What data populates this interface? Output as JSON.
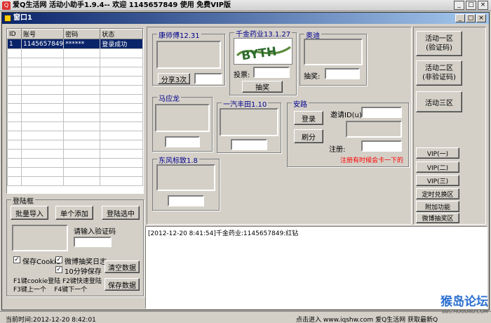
{
  "app": {
    "title": "爱Q生活网 活动小助手1.9.4-- 欢迎 1145657849 使用 免费VIP版"
  },
  "window": {
    "title": "窗口1"
  },
  "accounts": {
    "columns": [
      "ID",
      "账号",
      "密码",
      "状态"
    ],
    "rows": [
      {
        "id": "1",
        "account": "1145657849",
        "password": "******",
        "status": "登录成功"
      }
    ]
  },
  "login": {
    "title": "登陆框",
    "batch_import": "批量导入",
    "add_single": "单个添加",
    "login_selected": "登陆选中",
    "captcha_label": "请输入验证码",
    "save_cookie": "保存Cookie",
    "weibo_log": "微博抽奖日志",
    "save_10min": "10分钟保存",
    "clear_data": "清空数据",
    "save_data": "保存数据",
    "hotkeys_1": "F1键cookie登陆 F2键快速登陆",
    "hotkeys_2": "F3键上一个    F4键下一个"
  },
  "groups": {
    "kangshifu": {
      "title": "康师傅12.31",
      "share_button": "分享3次"
    },
    "qianjin": {
      "title": "千金药业13.1.27",
      "vote_label": "投票:",
      "draw_button": "抽奖",
      "captcha_text": "BYTH"
    },
    "aodi": {
      "title": "奥迪",
      "draw_label": "抽奖:"
    },
    "mayinglong": {
      "title": "马应龙"
    },
    "yiqi": {
      "title": "一汽丰田1.10"
    },
    "anlu": {
      "title": "安路",
      "login_button": "登录",
      "refresh_button": "刷分",
      "invite_label": "邀请ID(u)",
      "register_label": "注册:",
      "hint": "注册有时候会卡一下的"
    },
    "dongfeng": {
      "title": "东风标致1.8"
    }
  },
  "right_buttons": {
    "activity_1": "活动一区\n(验证码)",
    "activity_2": "活动二区\n(非验证码)",
    "activity_3": "活动三区",
    "vip1": "VIP(一)",
    "vip2": "VIP(二)",
    "vip3": "VIP(三)",
    "timed_exchange": "定时兑换区",
    "addon": "附加功能",
    "weibo_draw": "微博抽奖区"
  },
  "log": {
    "line": "[2012-12-20 8:41:54]千金药业:1145657849:红钻"
  },
  "status": {
    "time": "当前时间:2012-12-20 8:42:01",
    "link": "点击进入 www.iqshw.com 爱Q生活网 获取最新Q",
    "watermark": "猴岛论坛",
    "watermark_url": "BBS.HOUDAO.COM"
  },
  "colors": {
    "accent": "#0a246a",
    "hint": "#ff0000",
    "group_title": "#00008b"
  }
}
